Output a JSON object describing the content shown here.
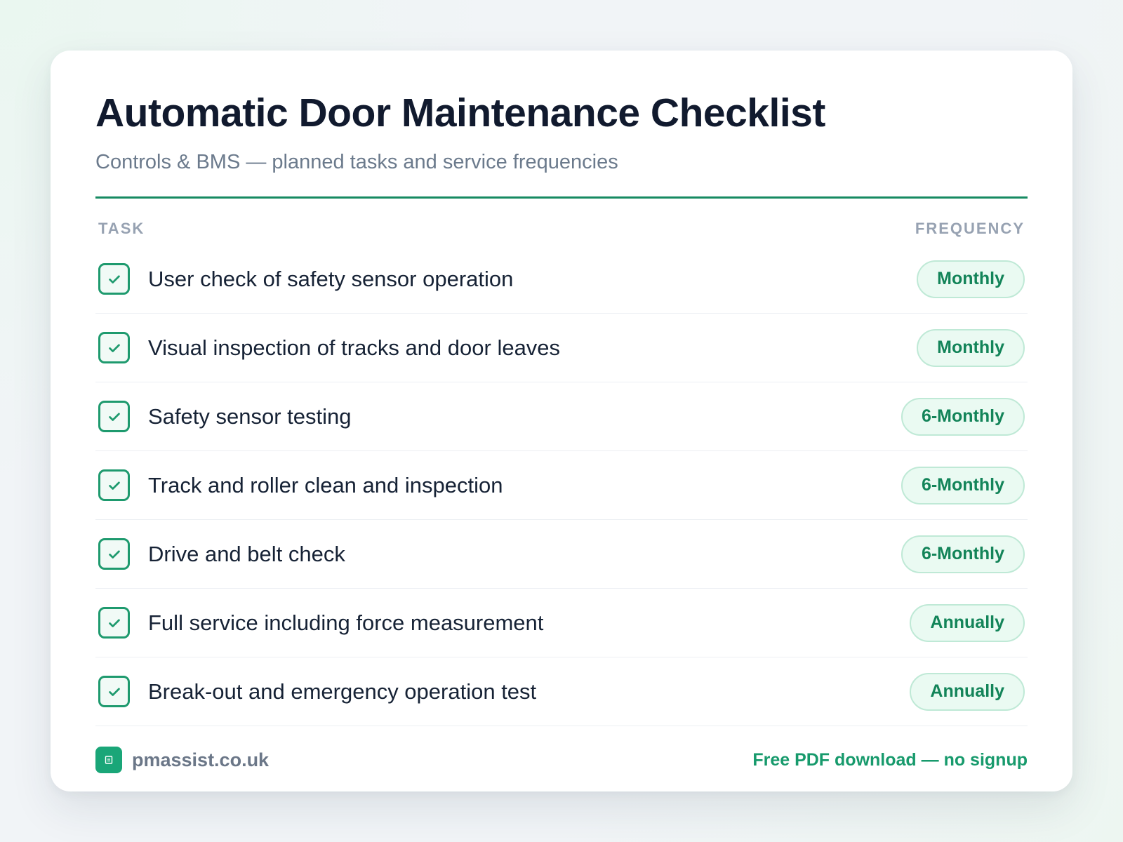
{
  "header": {
    "title": "Automatic Door Maintenance Checklist",
    "subtitle": "Controls & BMS — planned tasks and service frequencies"
  },
  "table": {
    "columns": {
      "task": "TASK",
      "frequency": "FREQUENCY"
    },
    "rows": [
      {
        "task": "User check of safety sensor operation",
        "frequency": "Monthly",
        "checked": true
      },
      {
        "task": "Visual inspection of tracks and door leaves",
        "frequency": "Monthly",
        "checked": true
      },
      {
        "task": "Safety sensor testing",
        "frequency": "6-Monthly",
        "checked": true
      },
      {
        "task": "Track and roller clean and inspection",
        "frequency": "6-Monthly",
        "checked": true
      },
      {
        "task": "Drive and belt check",
        "frequency": "6-Monthly",
        "checked": true
      },
      {
        "task": "Full service including force measurement",
        "frequency": "Annually",
        "checked": true
      },
      {
        "task": "Break-out and emergency operation test",
        "frequency": "Annually",
        "checked": true
      }
    ]
  },
  "footer": {
    "site": "pmassist.co.uk",
    "cta": "Free PDF download — no signup",
    "logo_icon": "building-icon"
  },
  "icons": {
    "row_check": "checkmark-icon"
  },
  "colors": {
    "accent": "#168a62",
    "badge_bg": "#eafaf2",
    "badge_border": "#bfe9d6",
    "badge_text": "#138459",
    "title_text": "#111a2e",
    "subtitle_text": "#6b7a8c"
  }
}
